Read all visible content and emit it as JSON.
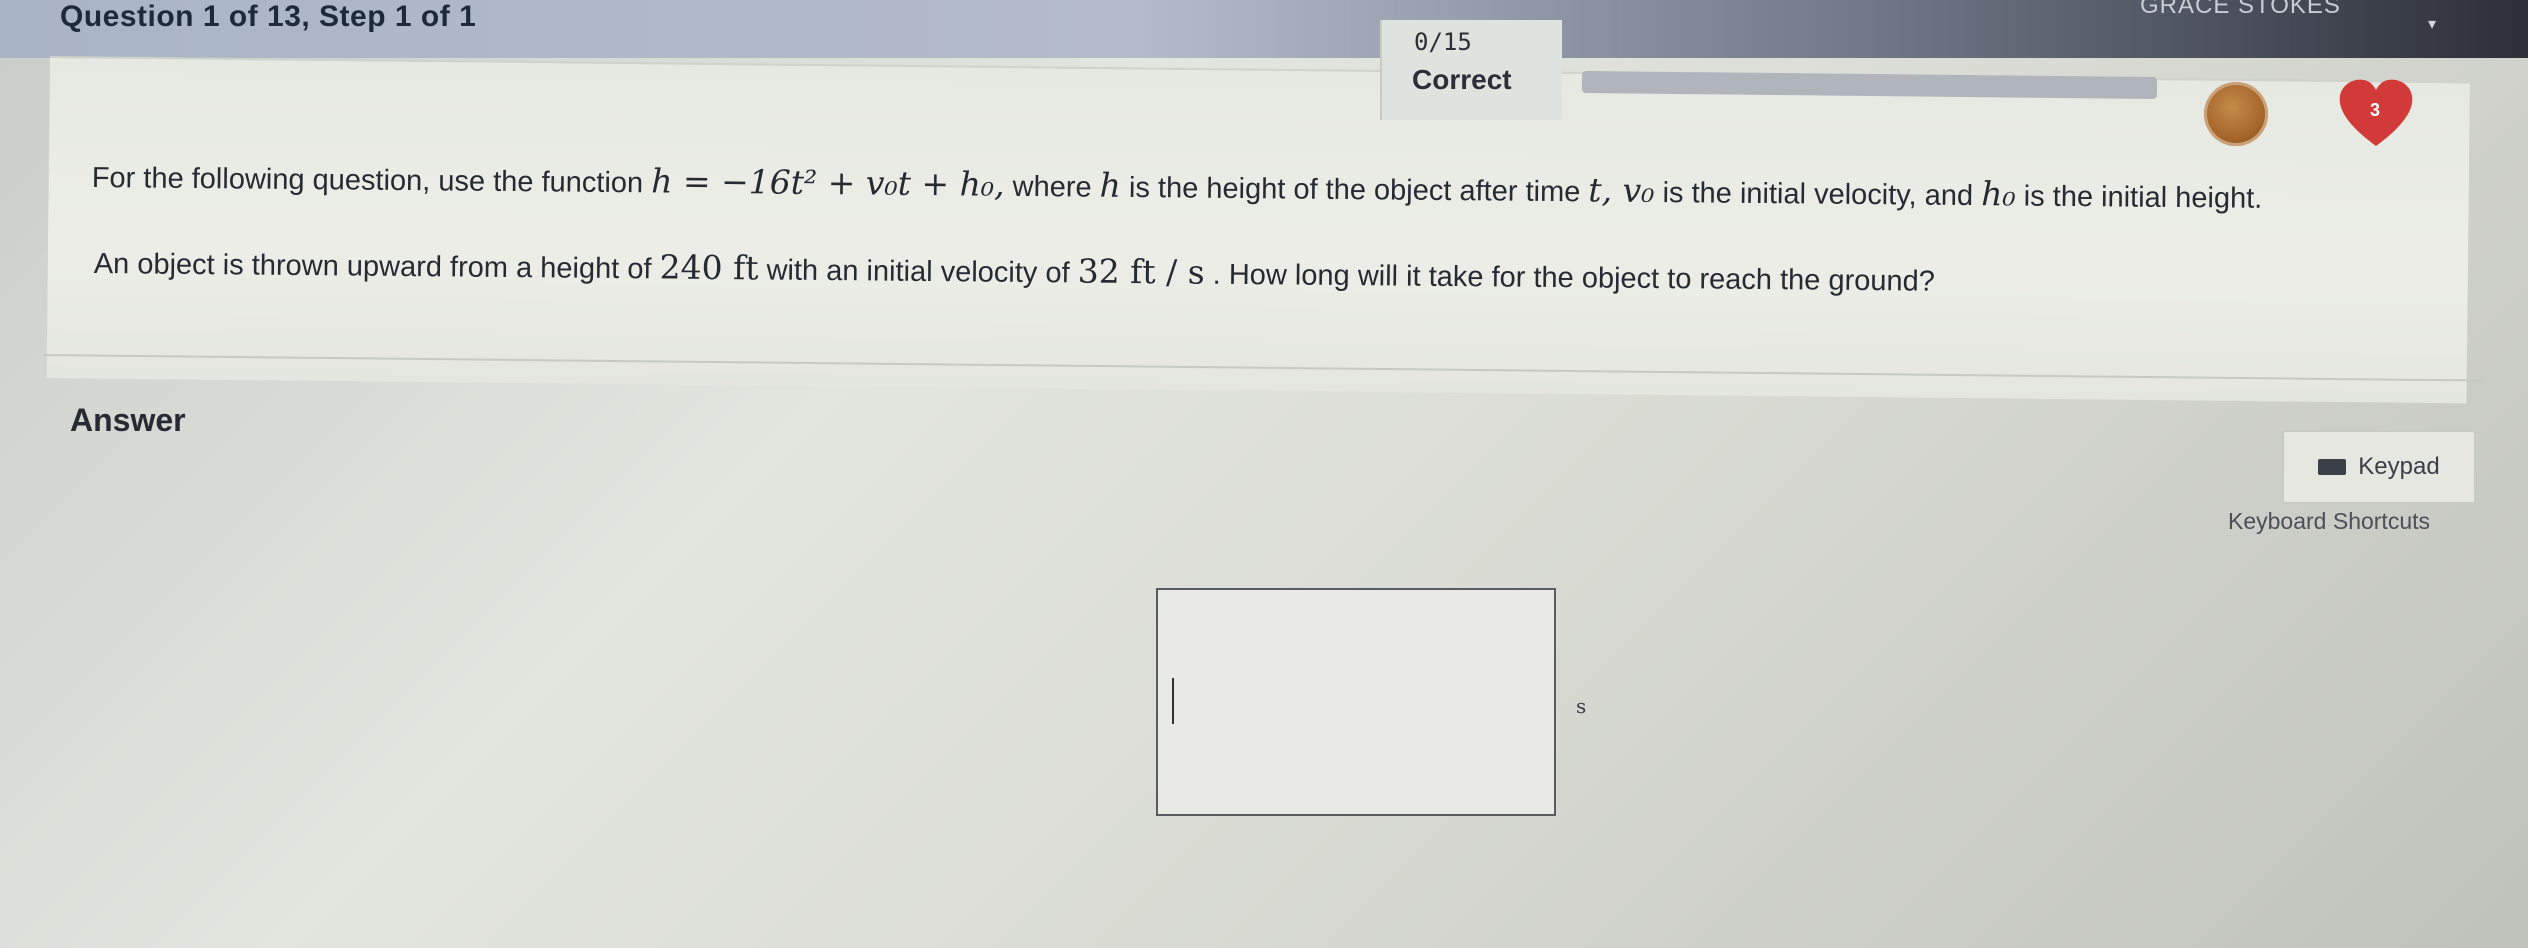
{
  "header": {
    "question_step": "Question 1 of 13, Step 1 of 1",
    "user_name": "GRACE STOKES",
    "user_menu_caret": "▾"
  },
  "score": {
    "count": "0/15",
    "status": "Correct",
    "progress_fraction": 0.0
  },
  "badges": {
    "heart_count": "3"
  },
  "question": {
    "line1": {
      "intro": "For the following question, use the function ",
      "formula": "h = −16t² + v₀t + h₀,",
      "mid1": " where ",
      "h_var": "h",
      "mid2": " is the height of the object after time ",
      "t_var": "t,",
      "v_var": " v₀",
      "mid3": " is the initial velocity, and ",
      "h0_var": "h₀",
      "end": " is the initial height."
    },
    "line2": {
      "part1": "An object is thrown upward from a height of ",
      "height_value": "240 ft",
      "part2": " with an initial velocity of ",
      "velocity_value": "32 ft / s",
      "part3": " . How long will it take for the object to reach the ground?"
    }
  },
  "answer": {
    "label": "Answer",
    "value": "",
    "unit": "s"
  },
  "tools": {
    "keypad_label": "Keypad",
    "shortcuts_label": "Keyboard Shortcuts"
  },
  "colors": {
    "heart": "#d23a3a",
    "gem": "#a8692d",
    "text": "#262b33"
  }
}
